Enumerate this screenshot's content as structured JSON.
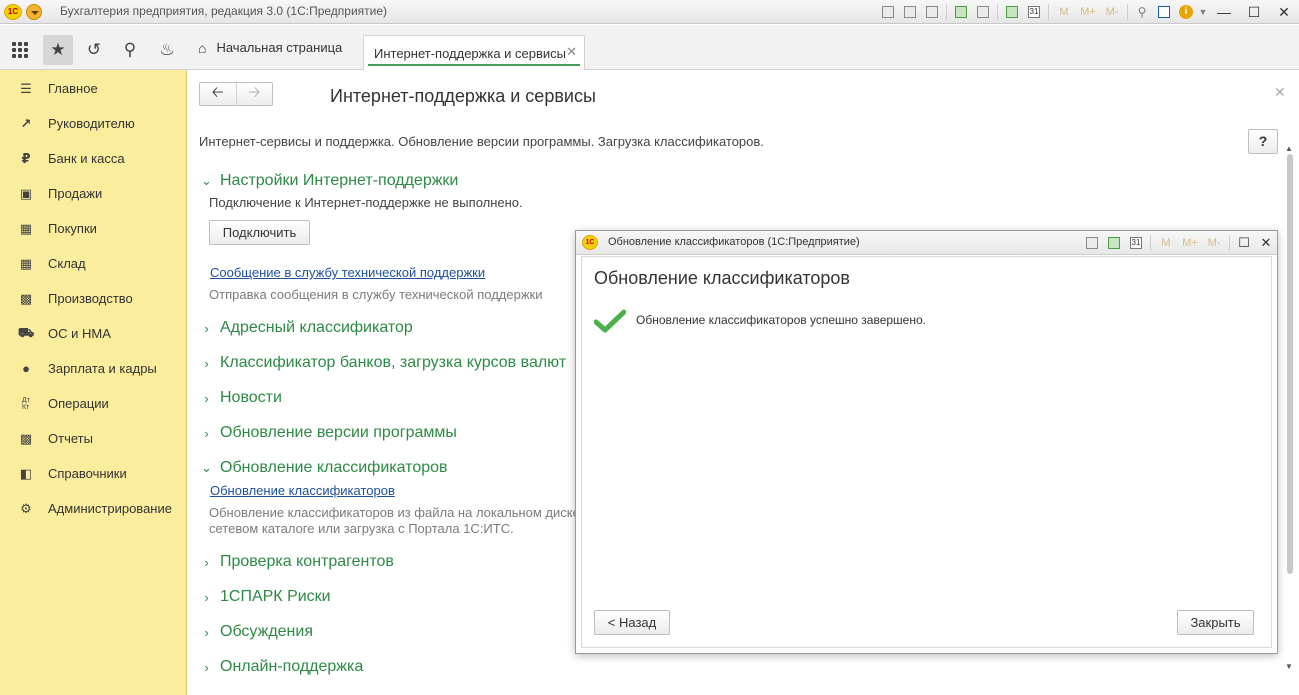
{
  "window": {
    "logo_text": "1С",
    "title": "Бухгалтерия предприятия, редакция 3.0  (1С:Предприятие)",
    "m_labels": [
      "M",
      "M+",
      "M-"
    ],
    "calendar_day": "31",
    "info_label": "i"
  },
  "tabs": {
    "home_label": "Начальная страница",
    "active_label": "Интернет-поддержка и сервисы"
  },
  "sidebar": {
    "items": [
      {
        "label": "Главное",
        "icon": "menu-lines-icon"
      },
      {
        "label": "Руководителю",
        "icon": "trend-up-icon"
      },
      {
        "label": "Банк и касса",
        "icon": "ruble-coin-icon"
      },
      {
        "label": "Продажи",
        "icon": "shopping-bag-icon"
      },
      {
        "label": "Покупки",
        "icon": "cart-icon"
      },
      {
        "label": "Склад",
        "icon": "warehouse-icon"
      },
      {
        "label": "Производство",
        "icon": "factory-icon"
      },
      {
        "label": "ОС и НМА",
        "icon": "truck-icon"
      },
      {
        "label": "Зарплата и кадры",
        "icon": "person-icon"
      },
      {
        "label": "Операции",
        "icon": "debit-credit-icon"
      },
      {
        "label": "Отчеты",
        "icon": "bar-chart-icon"
      },
      {
        "label": "Справочники",
        "icon": "books-icon"
      },
      {
        "label": "Администрирование",
        "icon": "gear-icon"
      }
    ],
    "debit_credit_glyph": "Дт\nКт"
  },
  "page": {
    "title": "Интернет-поддержка и сервисы",
    "description": "Интернет-сервисы и поддержка. Обновление версии программы. Загрузка классификаторов.",
    "help_label": "?",
    "sections": [
      {
        "label": "Настройки Интернет-поддержки",
        "expanded": true
      },
      {
        "label": "Адресный классификатор",
        "expanded": false
      },
      {
        "label": "Классификатор банков, загрузка курсов валют",
        "expanded": false
      },
      {
        "label": "Новости",
        "expanded": false
      },
      {
        "label": "Обновление версии программы",
        "expanded": false
      },
      {
        "label": "Обновление классификаторов",
        "expanded": true
      },
      {
        "label": "Проверка контрагентов",
        "expanded": false
      },
      {
        "label": "1СПАРК Риски",
        "expanded": false
      },
      {
        "label": "Обсуждения",
        "expanded": false
      },
      {
        "label": "Онлайн-поддержка",
        "expanded": false
      }
    ],
    "support": {
      "status": "Подключение к Интернет-поддержке не выполнено.",
      "connect_button": "Подключить",
      "message_link": "Сообщение в службу технической поддержки",
      "message_desc": "Отправка сообщения в службу технической поддержки"
    },
    "classifiers": {
      "link": "Обновление классификаторов",
      "desc_line1": "Обновление классификаторов из файла на локальном диске,",
      "desc_line2": "сетевом каталоге или загрузка с Портала 1С:ИТС."
    }
  },
  "modal": {
    "window_title": "Обновление классификаторов  (1С:Предприятие)",
    "heading": "Обновление классификаторов",
    "message": "Обновление классификаторов успешно завершено.",
    "back_button": "< Назад",
    "close_button": "Закрыть"
  },
  "colors": {
    "sidebar_bg": "#fbed9e",
    "section_green": "#2d8a45",
    "link_blue": "#1f4f9c",
    "check_green": "#4caf50"
  }
}
